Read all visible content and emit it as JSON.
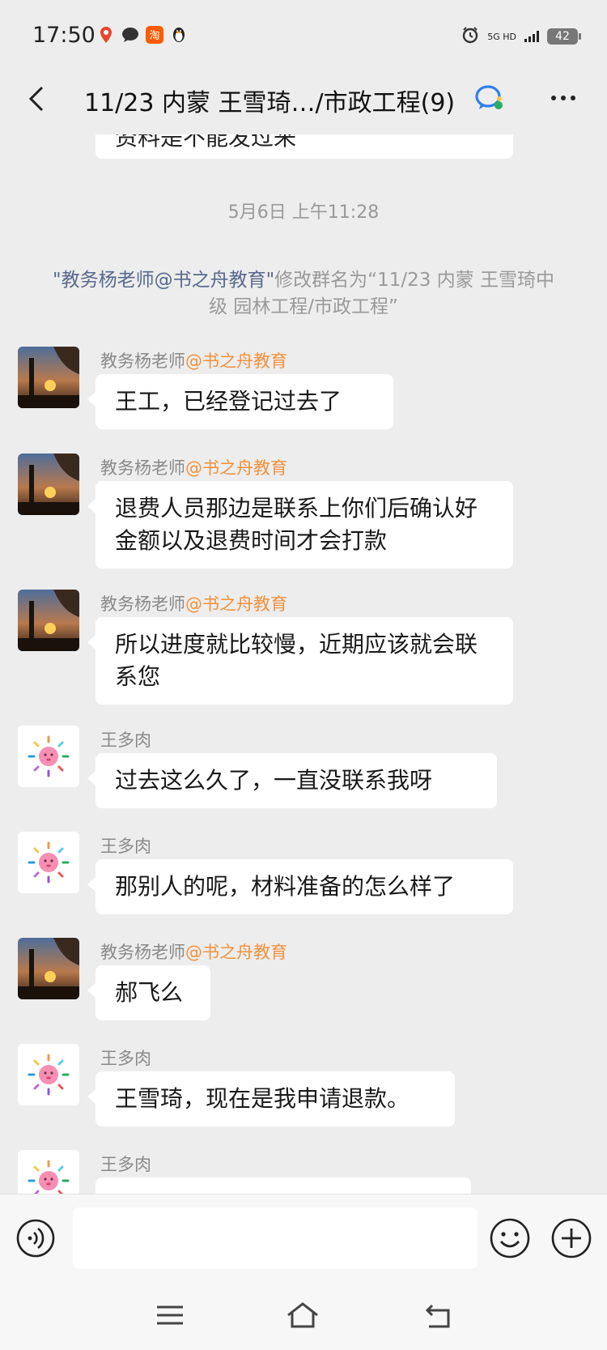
{
  "status_bar": {
    "time": "17:50",
    "network": "5G HD",
    "battery": "42"
  },
  "header": {
    "title": "11/23 内蒙 王雪琦…/市政工程(9)"
  },
  "chat": {
    "partial_top_text": "资料是不能发过来",
    "timestamp": "5月6日 上午11:28",
    "system_message": {
      "actor": "\"教务杨老师@书之舟教育\"",
      "text": "修改群名为“11/23 内蒙 王雪琦中级 园林工程/市政工程”"
    },
    "messages": [
      {
        "sender_name": "教务杨老师",
        "sender_org": "@书之舟教育",
        "text": "王工，已经登记过去了"
      },
      {
        "sender_name": "教务杨老师",
        "sender_org": "@书之舟教育",
        "text": "退费人员那边是联系上你们后确认好金额以及退费时间才会打款"
      },
      {
        "sender_name": "教务杨老师",
        "sender_org": "@书之舟教育",
        "text": "所以进度就比较慢，近期应该就会联系您"
      },
      {
        "sender_name": "王多肉",
        "sender_org": "",
        "text": "过去这么久了，一直没联系我呀"
      },
      {
        "sender_name": "王多肉",
        "sender_org": "",
        "text": "那别人的呢，材料准备的怎么样了"
      },
      {
        "sender_name": "教务杨老师",
        "sender_org": "@书之舟教育",
        "text": "郝飞么"
      },
      {
        "sender_name": "王多肉",
        "sender_org": "",
        "text": "王雪琦，现在是我申请退款。"
      },
      {
        "sender_name": "王多肉",
        "sender_org": "",
        "text": ""
      }
    ]
  },
  "input": {
    "placeholder": ""
  },
  "colors": {
    "background": "#ededed",
    "bubble": "#ffffff",
    "org_accent": "#f3913c",
    "link_name": "#58698e"
  }
}
